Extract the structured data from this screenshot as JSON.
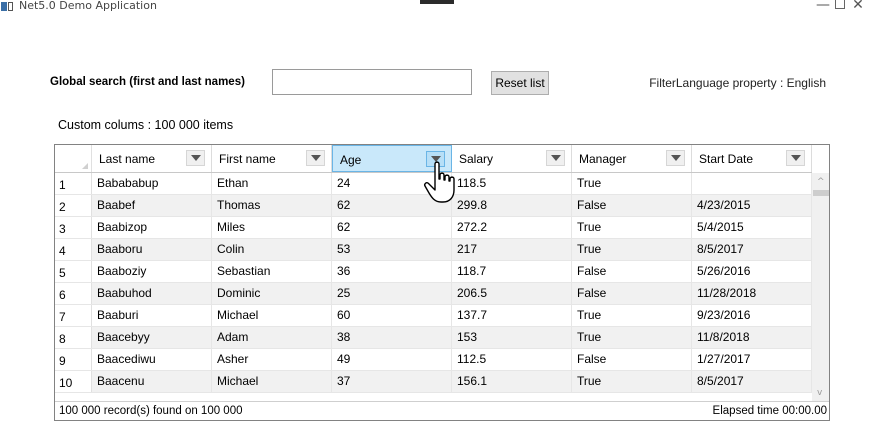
{
  "window": {
    "title": "Net5.0 Demo Application",
    "controls": {
      "minimize": "—",
      "close": "✕"
    }
  },
  "search": {
    "label": "Global search (first and last names)",
    "value": "",
    "placeholder": ""
  },
  "reset_button": {
    "label": "Reset list"
  },
  "filter_language": {
    "text": "FilterLanguage property : English"
  },
  "custom_columns": {
    "text": "Custom colums : 100 000 items"
  },
  "grid": {
    "columns": [
      "Last name",
      "First name",
      "Age",
      "Salary",
      "Manager",
      "Start Date"
    ],
    "rows": [
      {
        "n": "1",
        "last": "Babababup",
        "first": "Ethan",
        "age": "24",
        "salary": "118.5",
        "manager": "True",
        "start": ""
      },
      {
        "n": "2",
        "last": "Baabef",
        "first": "Thomas",
        "age": "62",
        "salary": "299.8",
        "manager": "False",
        "start": "4/23/2015"
      },
      {
        "n": "3",
        "last": "Baabizop",
        "first": "Miles",
        "age": "62",
        "salary": "272.2",
        "manager": "True",
        "start": "5/4/2015"
      },
      {
        "n": "4",
        "last": "Baaboru",
        "first": "Colin",
        "age": "53",
        "salary": "217",
        "manager": "True",
        "start": "8/5/2017"
      },
      {
        "n": "5",
        "last": "Baaboziy",
        "first": "Sebastian",
        "age": "36",
        "salary": "118.7",
        "manager": "False",
        "start": "5/26/2016"
      },
      {
        "n": "6",
        "last": "Baabuhod",
        "first": "Dominic",
        "age": "25",
        "salary": "206.5",
        "manager": "False",
        "start": "11/28/2018"
      },
      {
        "n": "7",
        "last": "Baaburi",
        "first": "Michael",
        "age": "60",
        "salary": "137.7",
        "manager": "True",
        "start": "9/23/2016"
      },
      {
        "n": "8",
        "last": "Baacebyy",
        "first": "Adam",
        "age": "38",
        "salary": "153",
        "manager": "True",
        "start": "11/8/2018"
      },
      {
        "n": "9",
        "last": "Baacediwu",
        "first": "Asher",
        "age": "49",
        "salary": "112.5",
        "manager": "False",
        "start": "1/27/2017"
      },
      {
        "n": "10",
        "last": "Baacenu",
        "first": "Michael",
        "age": "37",
        "salary": "156.1",
        "manager": "True",
        "start": "8/5/2017"
      }
    ],
    "active_column": "Age",
    "scroll_icons": {
      "up": "^",
      "down": "v"
    }
  },
  "status": {
    "records": "100 000 record(s) found on 100 000",
    "elapsed": "Elapsed time 00:00.00"
  },
  "icons": {
    "app": "app-window-icon",
    "dropdown": "chevron-down-icon",
    "cursor": "hand-pointer-icon"
  }
}
